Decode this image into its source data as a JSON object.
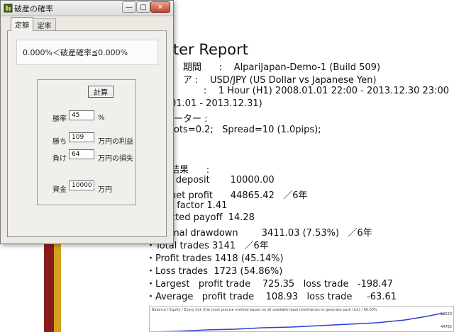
{
  "report": {
    "title": "ester Report",
    "lines": [
      {
        "text": "期間      :    AlpariJapan-Demo-1 (Build 509)"
      },
      {
        "text": "ア :    USD/JPY (US Dollar vs Japanese Yen)"
      },
      {
        "text": "       :    1 Hour (H1) 2008.01.01 22:00 - 2013.12.30 23:00"
      },
      {
        "text": "01.01 - 2013.12.31)"
      },
      {
        "text": "ーター :"
      },
      {
        "text": "ots=0.2;   Spread=10 (1.0pips);"
      },
      {
        "text": "結果      :"
      },
      {
        "text": "l deposit       10000.00"
      },
      {
        "text": "net profit      44865.42   ／6年"
      },
      {
        "text": "t factor 1.41"
      },
      {
        "text": "cted payoff  14.28"
      },
      {
        "text": "mal drawdown        3411.03 (7.53%)   ／6年"
      },
      {
        "text": "・Total trades 3141   ／6年"
      },
      {
        "text": "・Profit trades 1418 (45.14%)"
      },
      {
        "text": "・Loss trades  1723 (54.86%)"
      },
      {
        "text": "・Largest   profit trade    725.35   loss trade   -198.47"
      },
      {
        "text": "・Average   profit trade    108.93   loss trade     -63.61"
      }
    ],
    "chart": {
      "caption": "Balance / Equity / Every tick (the most precise method based on all available least timeframes to generate each tick) / 90.00%",
      "label_top": "54523",
      "label_bottom": "44782"
    }
  },
  "window": {
    "title": "破産の確率",
    "min_label": "—",
    "max_label": "□",
    "close_label": "✕",
    "tabs": [
      "定額",
      "定率"
    ],
    "result_text": "0.000%＜破産確率≦0.000%",
    "calc_button": "計算",
    "fields": {
      "win_rate": {
        "label": "勝率",
        "value": "45",
        "unit": "%"
      },
      "win_amount": {
        "label": "勝ち",
        "value": "109",
        "unit": "万円の利益"
      },
      "loss_amount": {
        "label": "負け",
        "value": "64",
        "unit": "万円の損失"
      },
      "capital": {
        "label": "資金",
        "value": "10000",
        "unit": "万円"
      }
    }
  },
  "colors": {
    "stripe_red": "#8b1c1c",
    "stripe_gold": "#d4a020",
    "close_button": "#c6442f"
  }
}
